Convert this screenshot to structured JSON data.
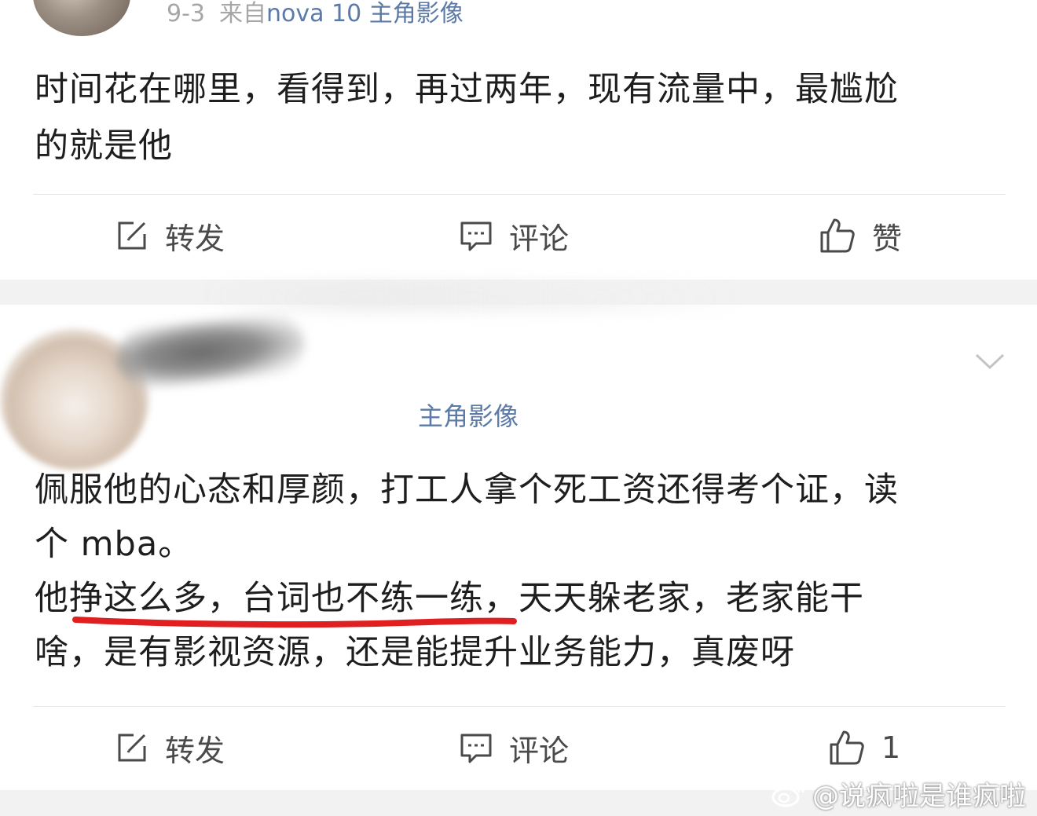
{
  "post1": {
    "date": "9-3",
    "from_label": "来自",
    "device": "nova 10 主角影像",
    "content_lines": [
      "时间花在哪里，看得到，再过两年，现有流量中，最尴尬",
      "的就是他"
    ],
    "actions": {
      "repost": "转发",
      "comment": "评论",
      "like": "赞"
    }
  },
  "post2": {
    "device_partial": "主角影像",
    "content_lines": [
      "佩服他的心态和厚颜，打工人拿个死工资还得考个证，读",
      "个 mba。",
      "他挣这么多，台词也不练一练，天天躲老家，老家能干",
      "啥，是有影视资源，还是能提升业务能力，真废呀"
    ],
    "actions": {
      "repost": "转发",
      "comment": "评论",
      "like_count": "1"
    }
  },
  "watermark": "@说疯啦是谁疯啦",
  "icons": {
    "repost": "edit-square-icon",
    "comment": "comment-bubble-icon",
    "like": "thumbs-up-icon",
    "more": "chevron-down-icon",
    "weibo": "weibo-logo-icon"
  },
  "colors": {
    "device_link": "#5b7aa8",
    "meta_gray": "#a6a6a6",
    "underline_red": "#e02020"
  }
}
